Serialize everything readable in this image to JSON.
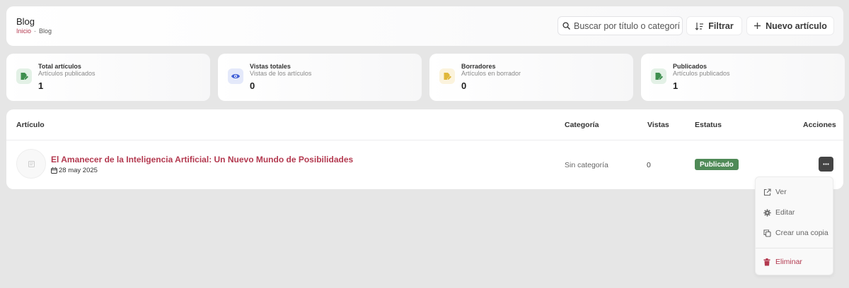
{
  "header": {
    "title": "Blog",
    "breadcrumb": {
      "home": "Inicio",
      "separator": "-",
      "current": "Blog"
    },
    "search_placeholder": "Buscar por título o categoría",
    "filter_label": "Filtrar",
    "new_label": "Nuevo artículo"
  },
  "stats": [
    {
      "label": "Total artículos",
      "sub": "Artículos publicados",
      "value": "1",
      "icon": "file-edit-icon",
      "color": "#3f8f4f",
      "bg": "#e3f1e6"
    },
    {
      "label": "Vistas totales",
      "sub": "Vistas de los artículos",
      "value": "0",
      "icon": "eye-icon",
      "color": "#3f5ed6",
      "bg": "#e4e9fa"
    },
    {
      "label": "Borradores",
      "sub": "Artículos en borrador",
      "value": "0",
      "icon": "file-edit-icon",
      "color": "#e0b73a",
      "bg": "#fbf3dd"
    },
    {
      "label": "Publicados",
      "sub": "Artículos publicados",
      "value": "1",
      "icon": "file-edit-icon",
      "color": "#3f8f4f",
      "bg": "#e3f1e6"
    }
  ],
  "table": {
    "headers": {
      "article": "Artículo",
      "category": "Categoría",
      "views": "Vistas",
      "status": "Estatus",
      "actions": "Acciones"
    },
    "rows": [
      {
        "title": "El Amanecer de la Inteligencia Artificial: Un Nuevo Mundo de Posibilidades",
        "date": "28 may 2025",
        "category": "Sin categoría",
        "views": "0",
        "status": "Publicado"
      }
    ]
  },
  "menu": {
    "items": [
      {
        "label": "Ver",
        "icon": "external-link-icon"
      },
      {
        "label": "Editar",
        "icon": "gear-icon"
      },
      {
        "label": "Crear una copia",
        "icon": "copy-icon"
      },
      {
        "label": "Eliminar",
        "icon": "trash-icon"
      }
    ]
  },
  "colors": {
    "accent": "#b3394f",
    "success": "#4f8a57",
    "background": "#e6e6e6"
  }
}
